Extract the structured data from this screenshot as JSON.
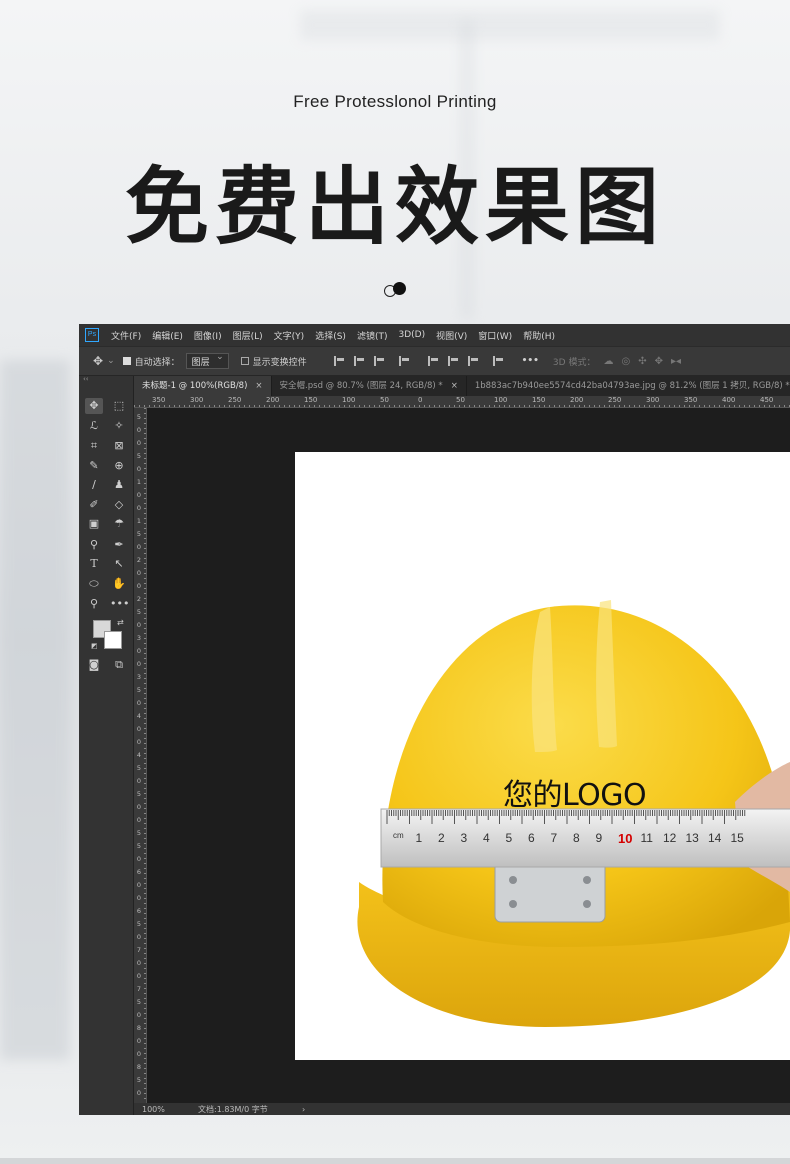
{
  "hero": {
    "subtitle": "Free Protesslonol Printing",
    "title": "免费出效果图"
  },
  "ps": {
    "logo": "Ps",
    "menu": [
      "文件(F)",
      "编辑(E)",
      "图像(I)",
      "图层(L)",
      "文字(Y)",
      "选择(S)",
      "滤镜(T)",
      "3D(D)",
      "视图(V)",
      "窗口(W)",
      "帮助(H)"
    ],
    "options": {
      "auto_select_label": "自动选择：",
      "auto_select_value": "图层",
      "show_transform_label": "显示变换控件",
      "more_label": "•••",
      "mode_3d_label": "3D 模式："
    },
    "tabs": [
      {
        "label": "未标题-1 @ 100%(RGB/8)",
        "close": "×"
      },
      {
        "label": "安全帽.psd @ 80.7% (图层 24, RGB/8) *",
        "close": "×"
      },
      {
        "label": "1b883ac7b940ee5574cd42ba04793ae.jpg @ 81.2% (图层 1 拷贝, RGB/8) *",
        "close": "×"
      }
    ],
    "ruler_top": [
      "350",
      "300",
      "250",
      "200",
      "150",
      "100",
      "50",
      "0",
      "50",
      "100",
      "150",
      "200",
      "250",
      "300",
      "350",
      "400",
      "450"
    ],
    "ruler_left": [
      "5",
      "0",
      "0",
      "5",
      "0",
      "1",
      "0",
      "0",
      "1",
      "5",
      "0",
      "2",
      "0",
      "0",
      "2",
      "5",
      "0",
      "3",
      "0",
      "0",
      "3",
      "5",
      "0",
      "4",
      "0",
      "0",
      "4",
      "5",
      "0",
      "5",
      "0",
      "0",
      "5",
      "5",
      "0",
      "6",
      "0",
      "0",
      "6",
      "5",
      "0",
      "7",
      "0",
      "0",
      "7",
      "5",
      "0",
      "8",
      "0",
      "0",
      "8",
      "5",
      "0"
    ],
    "status": {
      "zoom": "100%",
      "doc": "文档:1.83M/0 字节",
      "arrow": "›"
    },
    "collapse": "‹‹"
  },
  "canvas": {
    "logo_text": "您的LOGO",
    "tape_marks": [
      "cm",
      "1",
      "2",
      "3",
      "4",
      "5",
      "6",
      "7",
      "8",
      "9",
      "10",
      "11",
      "12",
      "13",
      "14",
      "15"
    ],
    "colors": {
      "helmet": "#f5c518",
      "helmet_shade": "#e0ac0c",
      "tape": "#e8e8e8",
      "tape_highlight": "#d40000"
    }
  },
  "icons": [
    "move-icon",
    "marquee-icon",
    "lasso-icon",
    "magic-wand-icon",
    "crop-icon",
    "frame-icon",
    "eyedropper-icon",
    "patch-icon",
    "brush-icon",
    "stamp-icon",
    "history-brush-icon",
    "eraser-icon",
    "gradient-icon",
    "smudge-icon",
    "dodge-icon",
    "pen-icon",
    "type-icon",
    "path-select-icon",
    "ellipse-icon",
    "hand-icon",
    "zoom-icon",
    "more-tools-icon",
    "quick-mask-icon",
    "screen-mode-icon"
  ]
}
